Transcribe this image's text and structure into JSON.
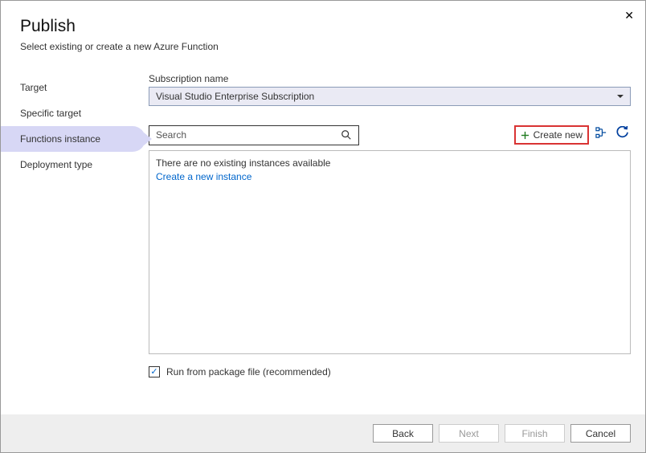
{
  "header": {
    "title": "Publish",
    "subtitle": "Select existing or create a new Azure Function"
  },
  "sidebar": {
    "items": [
      {
        "label": "Target"
      },
      {
        "label": "Specific target"
      },
      {
        "label": "Functions instance"
      },
      {
        "label": "Deployment type"
      }
    ]
  },
  "main": {
    "subscription_label": "Subscription name",
    "subscription_value": "Visual Studio Enterprise Subscription",
    "search_placeholder": "Search",
    "create_new_label": "Create new",
    "empty_message": "There are no existing instances available",
    "create_link": "Create a new instance",
    "checkbox_label": "Run from package file (recommended)",
    "checkbox_checked": true
  },
  "footer": {
    "back": "Back",
    "next": "Next",
    "finish": "Finish",
    "cancel": "Cancel"
  }
}
